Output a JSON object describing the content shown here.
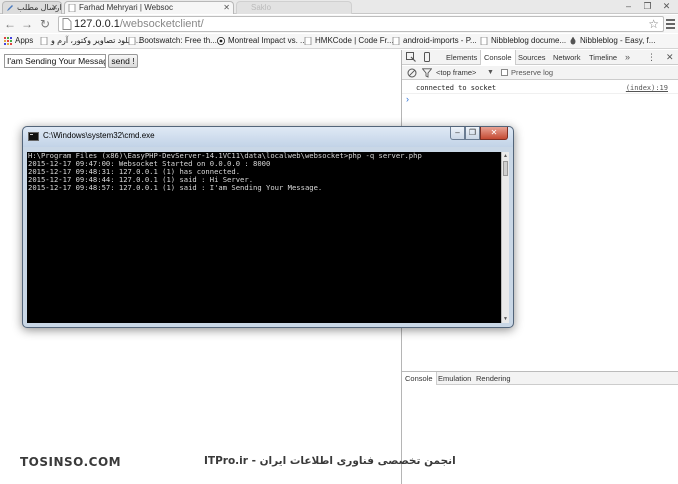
{
  "browser": {
    "tabs": [
      {
        "title": "ارسال مطلب"
      },
      {
        "title": "Farhad Mehryari | Websoc"
      },
      {
        "title": "Saklo"
      }
    ],
    "window_buttons": [
      "–",
      "❐",
      "✕"
    ],
    "url_host": "127.0.0.1",
    "url_path": "/websocketclient/",
    "bookmarks": [
      {
        "label": "Apps"
      },
      {
        "label": "دانلود تصاویر وکتور، آرم و..."
      },
      {
        "label": "Bootswatch: Free th..."
      },
      {
        "label": "Montreal Impact vs. ..."
      },
      {
        "label": "HMKCode | Code Fr..."
      },
      {
        "label": "android-imports - P..."
      },
      {
        "label": "Nibbleblog docume..."
      },
      {
        "label": "Nibbleblog - Easy, f..."
      }
    ]
  },
  "page": {
    "message_value": "I'am Sending Your Message",
    "send_label": "send !"
  },
  "devtools": {
    "tabs": [
      "Elements",
      "Console",
      "Sources",
      "Network",
      "Timeline"
    ],
    "active_tab": "Console",
    "more": "»",
    "frame": "<top frame>",
    "preserve_log": "Preserve log",
    "console_message": "connected to socket",
    "console_source": "(index):19",
    "prompt": "›",
    "drawer_tabs": [
      "Console",
      "Emulation",
      "Rendering"
    ]
  },
  "cmd": {
    "title": "C:\\Windows\\system32\\cmd.exe",
    "lines": [
      "H:\\Program Files (x86)\\EasyPHP-DevServer-14.1VC11\\data\\localweb\\websocket>php -q server.php",
      "2015-12-17 09:47:00: Websocket Started on 0.0.0.0 : 8000",
      "2015-12-17 09:48:31: 127.0.0.1 (1) has connected.",
      "2015-12-17 09:48:44: 127.0.0.1 (1) said : Hi Server.",
      "2015-12-17 09:48:57: 127.0.0.1 (1) said : I'am Sending Your Message."
    ]
  },
  "watermark": {
    "left": "TOSINSO.COM",
    "right": "ITPro.ir - انجمن تخصصی فناوری اطلاعات ایران"
  },
  "colors": {
    "console_bg": "#000000",
    "console_text": "#d9d9d9",
    "prompt": "#2a6fd6",
    "cmd_close": "#c44a33"
  }
}
